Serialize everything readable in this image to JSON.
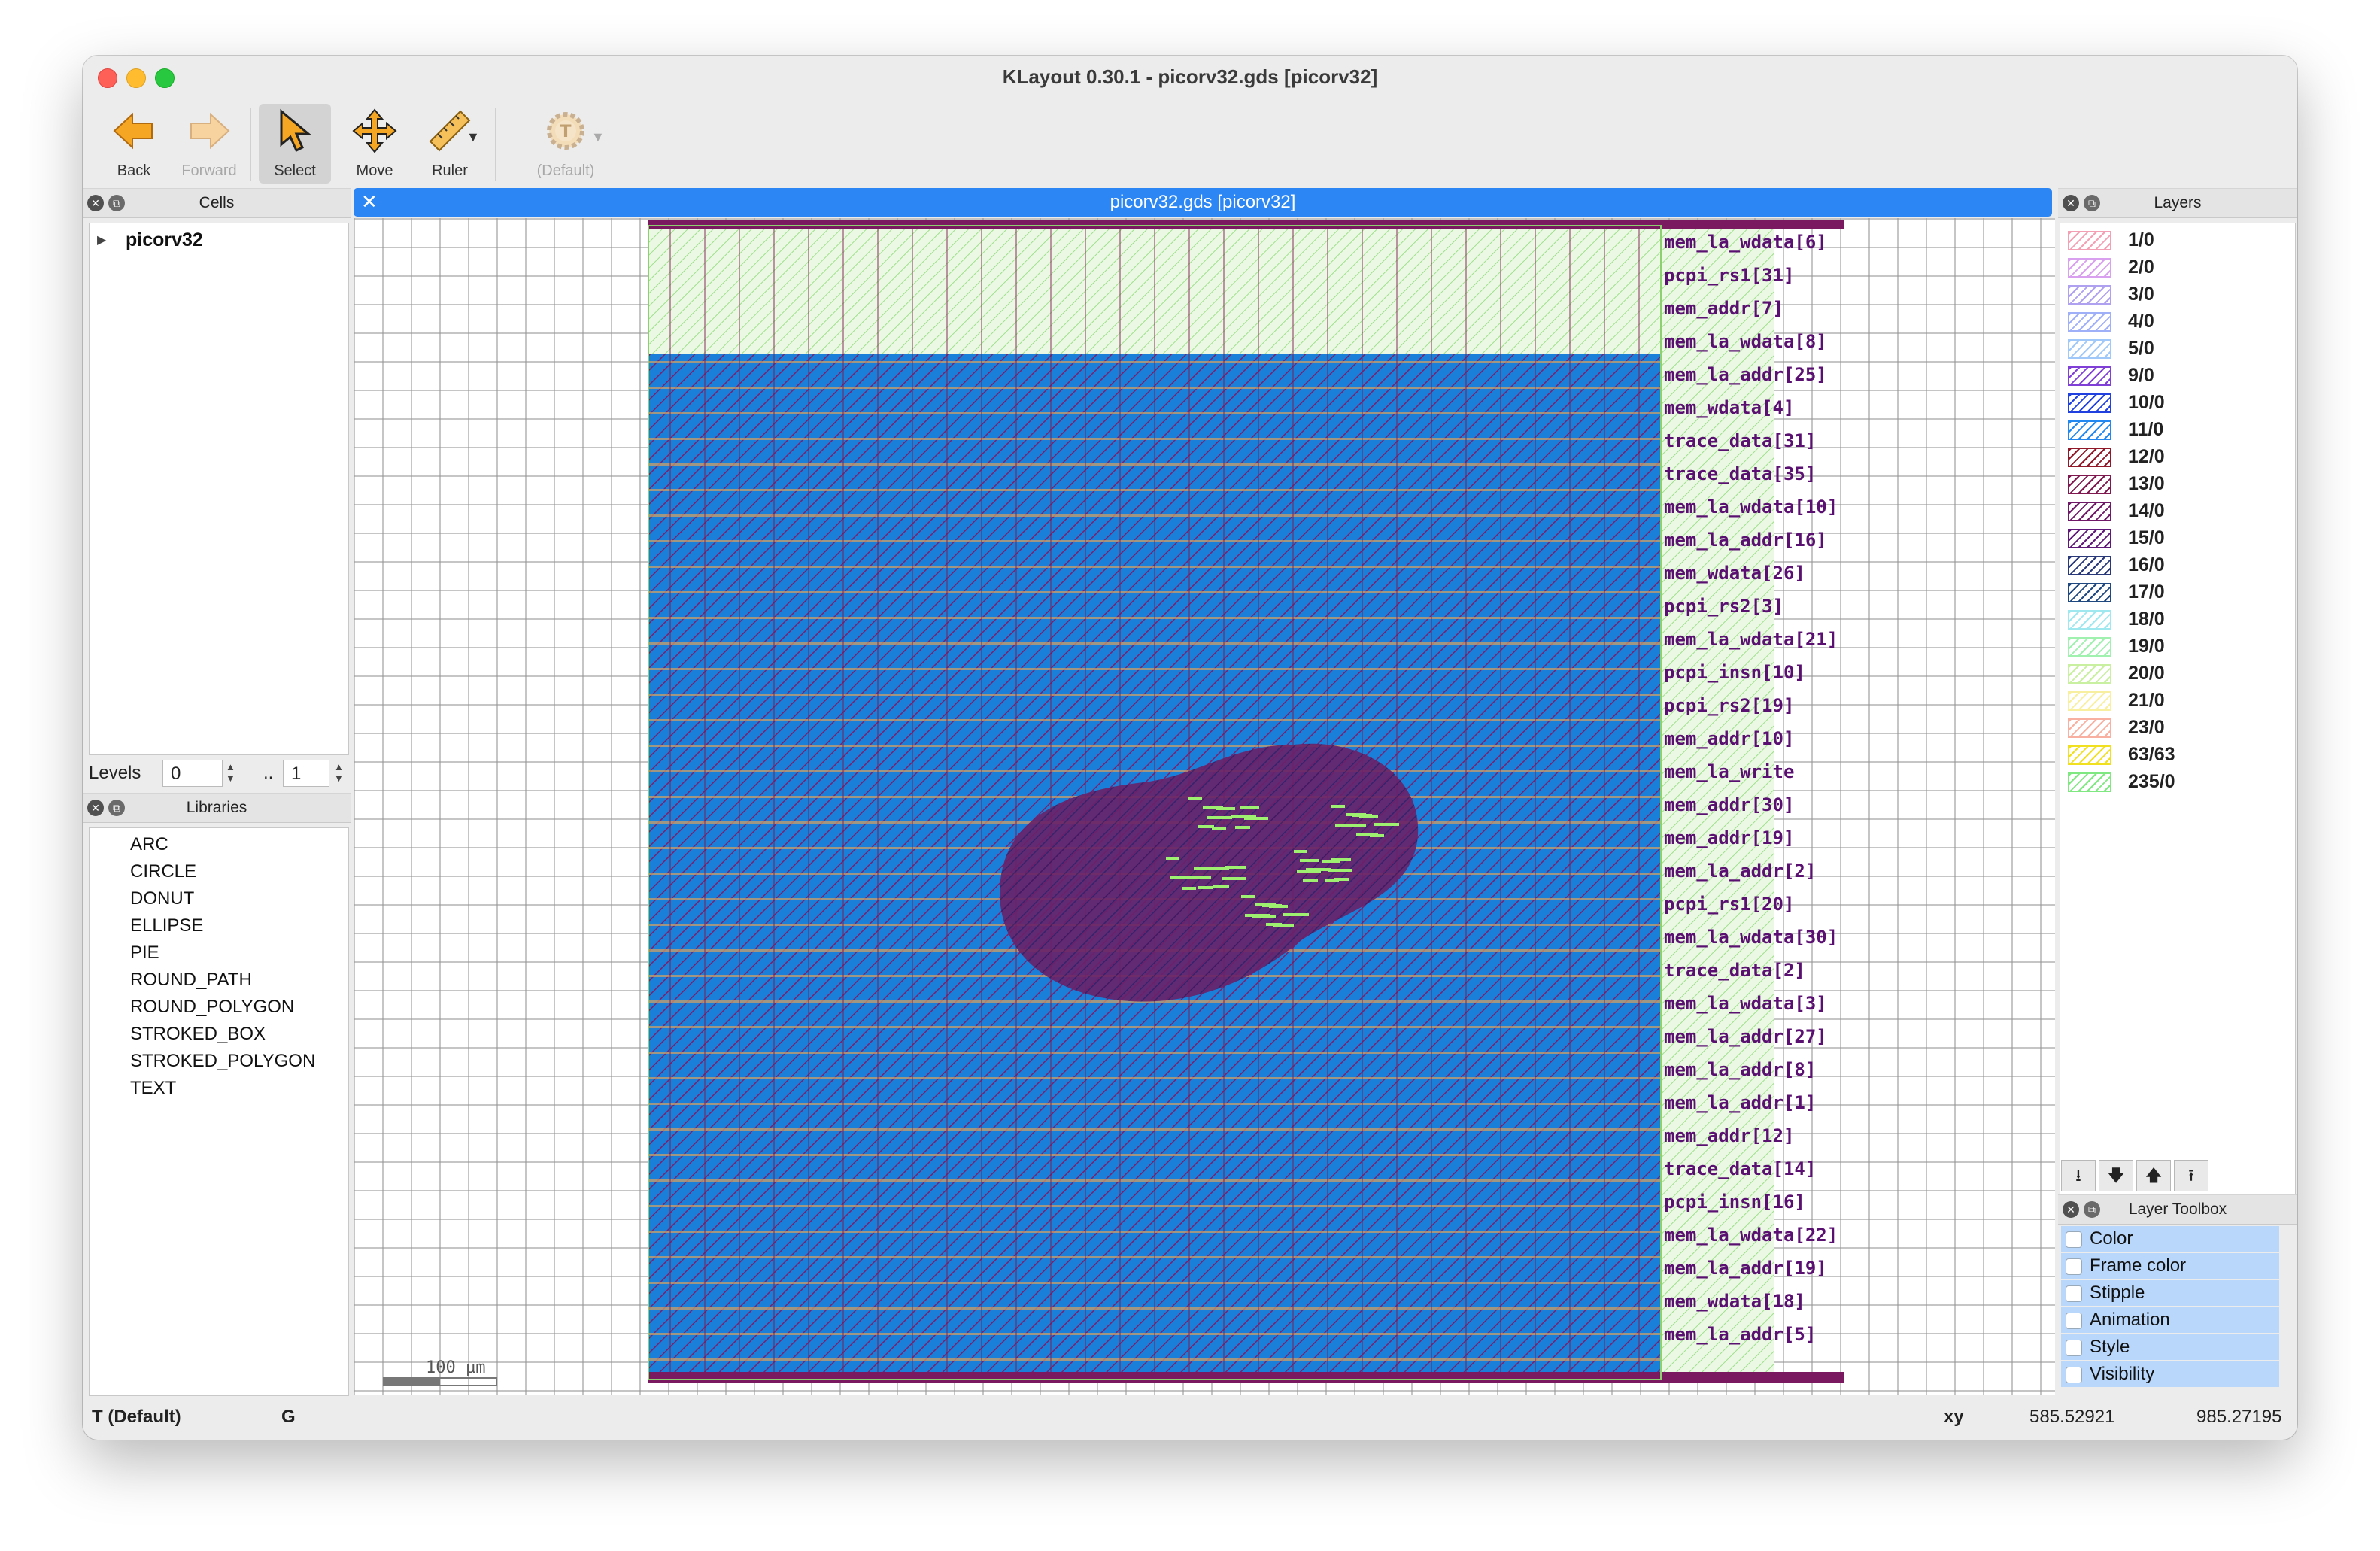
{
  "window": {
    "title": "KLayout 0.30.1 - picorv32.gds [picorv32]"
  },
  "toolbar": {
    "back": "Back",
    "forward": "Forward",
    "select": "Select",
    "move": "Move",
    "ruler": "Ruler",
    "default_template": "(Default)"
  },
  "cells_panel": {
    "title": "Cells",
    "items": [
      "picorv32"
    ],
    "levels_label": "Levels",
    "level_from": "0",
    "level_sep": "..",
    "level_to": "1"
  },
  "libraries_panel": {
    "title": "Libraries",
    "items": [
      "ARC",
      "CIRCLE",
      "DONUT",
      "ELLIPSE",
      "PIE",
      "ROUND_PATH",
      "ROUND_POLYGON",
      "STROKED_BOX",
      "STROKED_POLYGON",
      "TEXT"
    ]
  },
  "layout_view": {
    "tab_title": "picorv32.gds [picorv32]",
    "scale_label": "100 µm",
    "pin_labels": [
      "mem_la_wdata[6]",
      "pcpi_rs1[31]",
      "mem_addr[7]",
      "mem_la_wdata[8]",
      "mem_la_addr[25]",
      "mem_wdata[4]",
      "trace_data[31]",
      "trace_data[35]",
      "mem_la_wdata[10]",
      "mem_la_addr[16]",
      "mem_wdata[26]",
      "pcpi_rs2[3]",
      "mem_la_wdata[21]",
      "pcpi_insn[10]",
      "pcpi_rs2[19]",
      "mem_addr[10]",
      "mem_la_write",
      "mem_addr[30]",
      "mem_addr[19]",
      "mem_la_addr[2]",
      "pcpi_rs1[20]",
      "mem_la_wdata[30]",
      "trace_data[2]",
      "mem_la_wdata[3]",
      "mem_la_addr[27]",
      "mem_la_addr[8]",
      "mem_la_addr[1]",
      "mem_addr[12]",
      "trace_data[14]",
      "pcpi_insn[16]",
      "mem_la_wdata[22]",
      "mem_la_addr[19]",
      "mem_wdata[18]",
      "mem_la_addr[5]"
    ]
  },
  "layers_panel": {
    "title": "Layers",
    "layers": [
      {
        "name": "1/0",
        "color": "#f4a0b4"
      },
      {
        "name": "2/0",
        "color": "#d9a0f0"
      },
      {
        "name": "3/0",
        "color": "#b0a0f0"
      },
      {
        "name": "4/0",
        "color": "#a0b0f8"
      },
      {
        "name": "5/0",
        "color": "#a0c8f8"
      },
      {
        "name": "9/0",
        "color": "#8040d8"
      },
      {
        "name": "10/0",
        "color": "#2040e0"
      },
      {
        "name": "11/0",
        "color": "#2088f0"
      },
      {
        "name": "12/0",
        "color": "#901828"
      },
      {
        "name": "13/0",
        "color": "#801850"
      },
      {
        "name": "14/0",
        "color": "#701868"
      },
      {
        "name": "15/0",
        "color": "#601878"
      },
      {
        "name": "16/0",
        "color": "#283878"
      },
      {
        "name": "17/0",
        "color": "#204880"
      },
      {
        "name": "18/0",
        "color": "#a0e8f0"
      },
      {
        "name": "19/0",
        "color": "#a0f0b0"
      },
      {
        "name": "20/0",
        "color": "#c8f0a0"
      },
      {
        "name": "21/0",
        "color": "#f8f0a0"
      },
      {
        "name": "23/0",
        "color": "#f8b0a0"
      },
      {
        "name": "63/63",
        "color": "#f0e020"
      },
      {
        "name": "235/0",
        "color": "#80e880"
      }
    ]
  },
  "layer_toolbox": {
    "title": "Layer Toolbox",
    "items": [
      "Color",
      "Frame color",
      "Stipple",
      "Animation",
      "Style",
      "Visibility"
    ]
  },
  "statusbar": {
    "template": "T  (Default)",
    "grid": "G",
    "coord_label": "xy",
    "x": "585.52921",
    "y": "985.27195"
  }
}
